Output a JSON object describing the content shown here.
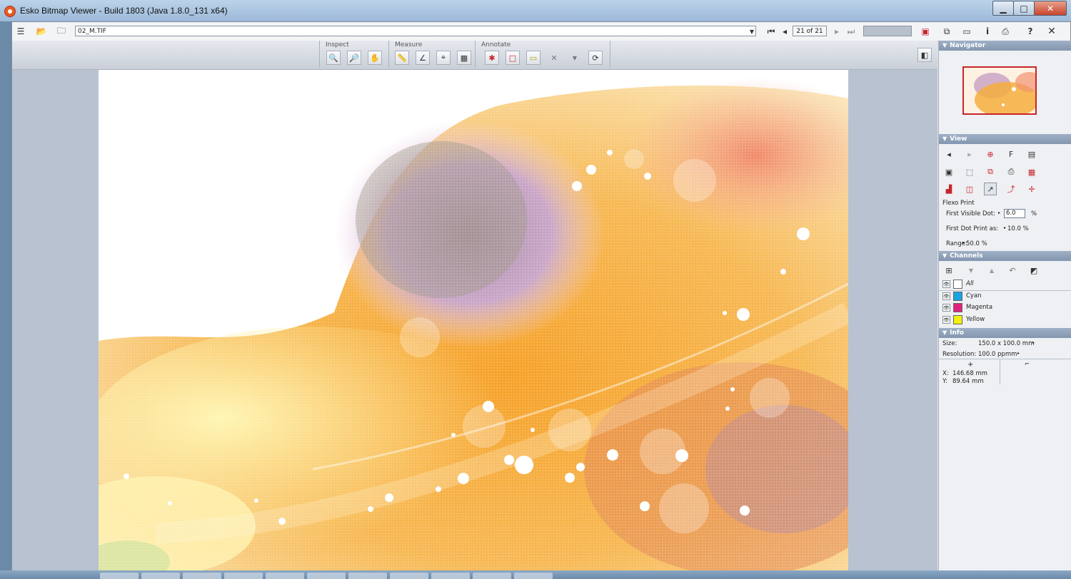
{
  "window": {
    "title": "Esko Bitmap Viewer - Build 1803 (Java 1.8.0_131 x64)",
    "min_icon": "minimize-icon",
    "max_icon": "maximize-icon",
    "close_icon": "close-icon"
  },
  "toolbar": {
    "file_name": "02_M.TIF",
    "page_indicator": "21 of 21"
  },
  "tool_groups": {
    "inspect": {
      "label": "Inspect",
      "tools": [
        "zoom-in-icon",
        "zoom-out-icon",
        "hand-icon"
      ]
    },
    "measure": {
      "label": "Measure",
      "tools": [
        "ruler-icon",
        "angle-icon",
        "densitometer-icon",
        "dot-measure-icon"
      ]
    },
    "annotate": {
      "label": "Annotate",
      "tools": [
        "mark-icon",
        "rectangle-icon",
        "note-icon",
        "delete-icon",
        "dropdown-icon",
        "refresh-icon"
      ]
    }
  },
  "navigator": {
    "label": "Navigator"
  },
  "view": {
    "label": "View",
    "flexo": {
      "title": "Flexo Print",
      "first_visible_label": "First Visible Dot:",
      "first_visible_value": "6.0",
      "first_visible_unit": "%",
      "first_dot_label": "First Dot Print as:",
      "first_dot_value": "10.0 %",
      "range_label": "Range:",
      "range_value": "50.0 %"
    }
  },
  "channels": {
    "label": "Channels",
    "items": [
      {
        "name": "All",
        "color": "#ffffff"
      },
      {
        "name": "Cyan",
        "color": "#1aa3e0"
      },
      {
        "name": "Magenta",
        "color": "#e0237e"
      },
      {
        "name": "Yellow",
        "color": "#f4ef10"
      }
    ]
  },
  "info": {
    "label": "Info",
    "size_label": "Size:",
    "size_value": "150.0 x 100.0 mm",
    "resolution_label": "Resolution:",
    "resolution_value": "100.0 ppmm",
    "x_label": "X:",
    "x_value": "146.68 mm",
    "y_label": "Y:",
    "y_value": "89.64 mm"
  },
  "colors": {
    "accent": "#c8252a",
    "panel_header": "#8fa2bb"
  }
}
